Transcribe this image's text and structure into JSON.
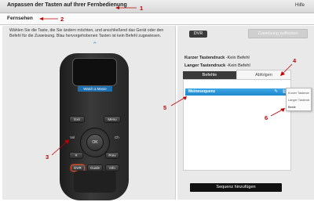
{
  "header": {
    "title": "Anpassen der Tasten auf Ihrer Fernbedienung",
    "help": "Hilfe"
  },
  "subheader": {
    "title": "Fernsehen"
  },
  "left": {
    "instructions": "Wählen Sie die Taste, die Sie ändern möchten, und anschließend das Gerät oder den Befehl für die Zuweisung. Blau hervorgehobenen Tasten ist kein Befehl zugewiesen.",
    "remote": {
      "screen_label": "Watch a Movie",
      "buttons": {
        "exit": "Exit",
        "menu": "Menu",
        "vol": "Vol",
        "ch": "Ch",
        "ok": "OK",
        "mute": "Mute",
        "prev": "Prev",
        "dvr": "DVR",
        "guide": "Guide",
        "info": "Info"
      }
    }
  },
  "right": {
    "selected_button": "DVR",
    "reset_button": "Zuweisung aufheben",
    "short_press": {
      "label": "Kurzer Tastendruck",
      "value": " -Kein Befehl"
    },
    "long_press": {
      "label": "Langer Tastendruck",
      "value": " -Kein Befehl"
    },
    "tabs": [
      "Befehle",
      "Abfolgen"
    ],
    "active_tab": "Abfolgen",
    "sequence_name": "Meinesequenz",
    "context_menu": [
      "Kurzer Tastendr.",
      "Langer Tastendr.",
      "Beide"
    ],
    "add_sequence_button": "Sequenz hinzufügen"
  },
  "annotations": [
    "1",
    "2",
    "3",
    "4",
    "5",
    "6"
  ],
  "colors": {
    "accent_blue": "#1c86cc",
    "annotation_red": "#c00000",
    "dark_tab": "#3a3a3a"
  }
}
